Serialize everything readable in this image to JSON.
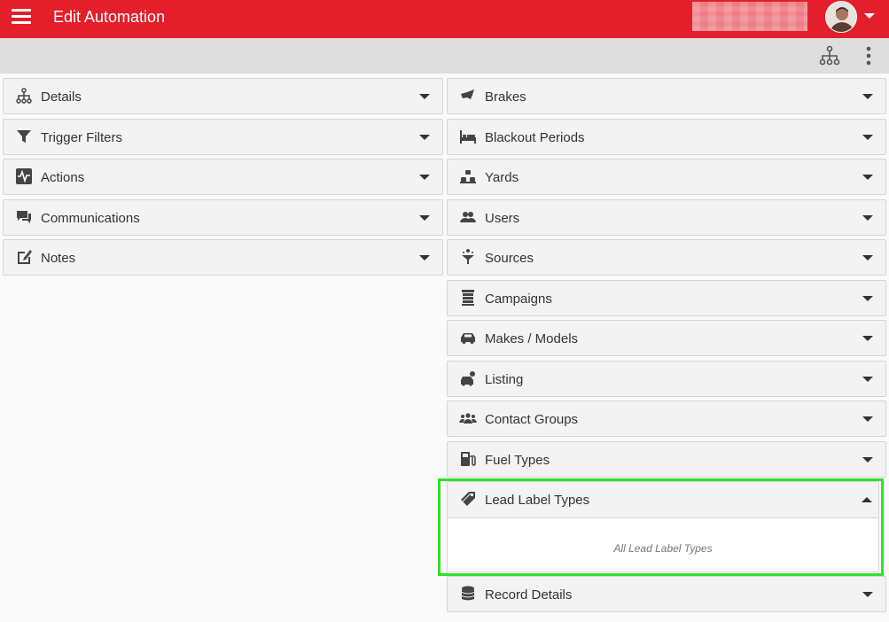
{
  "appbar": {
    "title": "Edit Automation",
    "icons": {
      "menu": "hamburger-menu-icon",
      "user_menu": "caret-down-icon"
    }
  },
  "toolbar": {
    "icons": [
      "sitemap-icon",
      "more-vertical-icon"
    ]
  },
  "left_panels": [
    {
      "label": "Details",
      "icon": "sitemap-icon"
    },
    {
      "label": "Trigger Filters",
      "icon": "filter-icon"
    },
    {
      "label": "Actions",
      "icon": "heartbeat-icon"
    },
    {
      "label": "Communications",
      "icon": "comments-icon"
    },
    {
      "label": "Notes",
      "icon": "edit-note-icon"
    }
  ],
  "right_panels": [
    {
      "label": "Brakes",
      "icon": "brakes-icon"
    },
    {
      "label": "Blackout Periods",
      "icon": "bed-icon"
    },
    {
      "label": "Yards",
      "icon": "yards-icon"
    },
    {
      "label": "Users",
      "icon": "users-icon"
    },
    {
      "label": "Sources",
      "icon": "funnel-icon"
    },
    {
      "label": "Campaigns",
      "icon": "campaigns-icon"
    },
    {
      "label": "Makes / Models",
      "icon": "car-icon"
    },
    {
      "label": "Listing",
      "icon": "car-listing-icon"
    },
    {
      "label": "Contact Groups",
      "icon": "group-icon"
    },
    {
      "label": "Fuel Types",
      "icon": "fuel-pump-icon"
    }
  ],
  "expanded_panel": {
    "label": "Lead Label Types",
    "icon": "tag-icon",
    "body": "All Lead Label Types"
  },
  "bottom_panel": {
    "label": "Record Details",
    "icon": "database-icon"
  },
  "colors": {
    "appbar": "#e41e2a",
    "toolbar": "#dedede",
    "panel": "#f3f3f3",
    "highlight": "#2ee02e"
  }
}
